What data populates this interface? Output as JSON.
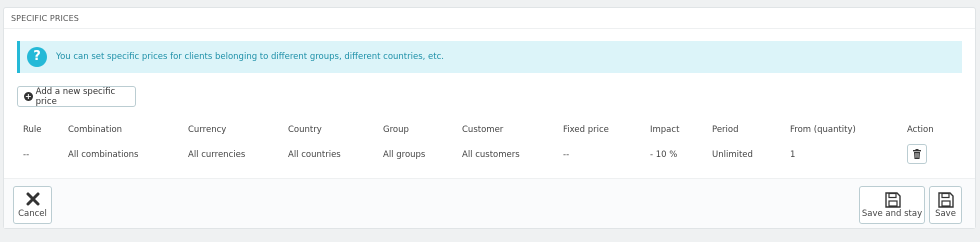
{
  "panel": {
    "title": "SPECIFIC PRICES",
    "info": "You can set specific prices for clients belonging to different groups, different countries, etc.",
    "add_button": "Add a new specific price"
  },
  "table": {
    "headers": [
      "Rule",
      "Combination",
      "Currency",
      "Country",
      "Group",
      "Customer",
      "Fixed price",
      "Impact",
      "Period",
      "From (quantity)",
      "Action"
    ],
    "rows": [
      [
        "--",
        "All combinations",
        "All currencies",
        "All countries",
        "All groups",
        "All customers",
        "--",
        "- 10 %",
        "Unlimited",
        "1"
      ]
    ]
  },
  "footer": {
    "cancel_label": "Cancel",
    "save_stay_label": "Save and stay",
    "save_label": "Save"
  },
  "icons": {
    "info": "question-circle-icon",
    "add": "plus-circle-icon",
    "delete": "trash-icon",
    "cancel": "close-icon",
    "save": "floppy-disk-icon"
  },
  "colors": {
    "alert_bg": "#dcf4f9",
    "alert_accent": "#25b9d7",
    "alert_text": "#1e90a8"
  }
}
